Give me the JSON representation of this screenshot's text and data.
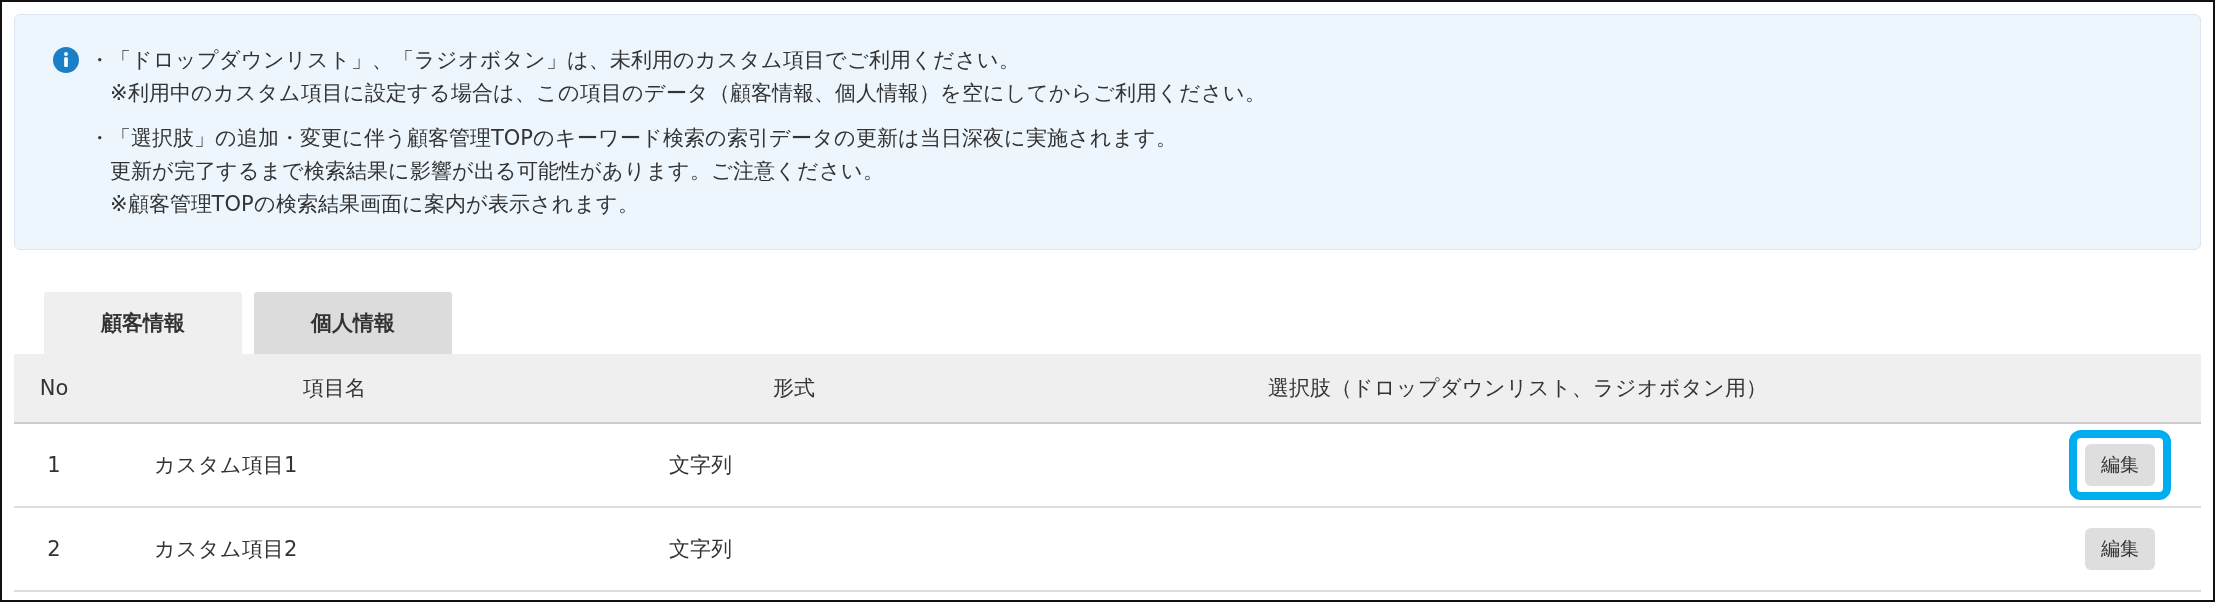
{
  "notice": {
    "paragraphs": [
      [
        "・「ドロップダウンリスト」、「ラジオボタン」は、未利用のカスタム項目でご利用ください。",
        "　※利用中のカスタム項目に設定する場合は、この項目のデータ（顧客情報、個人情報）を空にしてからご利用ください。"
      ],
      [
        "・「選択肢」の追加・変更に伴う顧客管理TOPのキーワード検索の索引データの更新は当日深夜に実施されます。",
        "　更新が完了するまで検索結果に影響が出る可能性があります。ご注意ください。",
        "　※顧客管理TOPの検索結果画面に案内が表示されます。"
      ]
    ]
  },
  "tabs": [
    {
      "label": "顧客情報",
      "selected": true
    },
    {
      "label": "個人情報",
      "selected": false
    }
  ],
  "table": {
    "columns": [
      "No",
      "項目名",
      "形式",
      "選択肢（ドロップダウンリスト、ラジオボタン用）"
    ],
    "rows": [
      {
        "no": "1",
        "name": "カスタム項目1",
        "format": "文字列",
        "action": "編集",
        "highlighted": true
      },
      {
        "no": "2",
        "name": "カスタム項目2",
        "format": "文字列",
        "action": "編集",
        "highlighted": false
      }
    ]
  }
}
